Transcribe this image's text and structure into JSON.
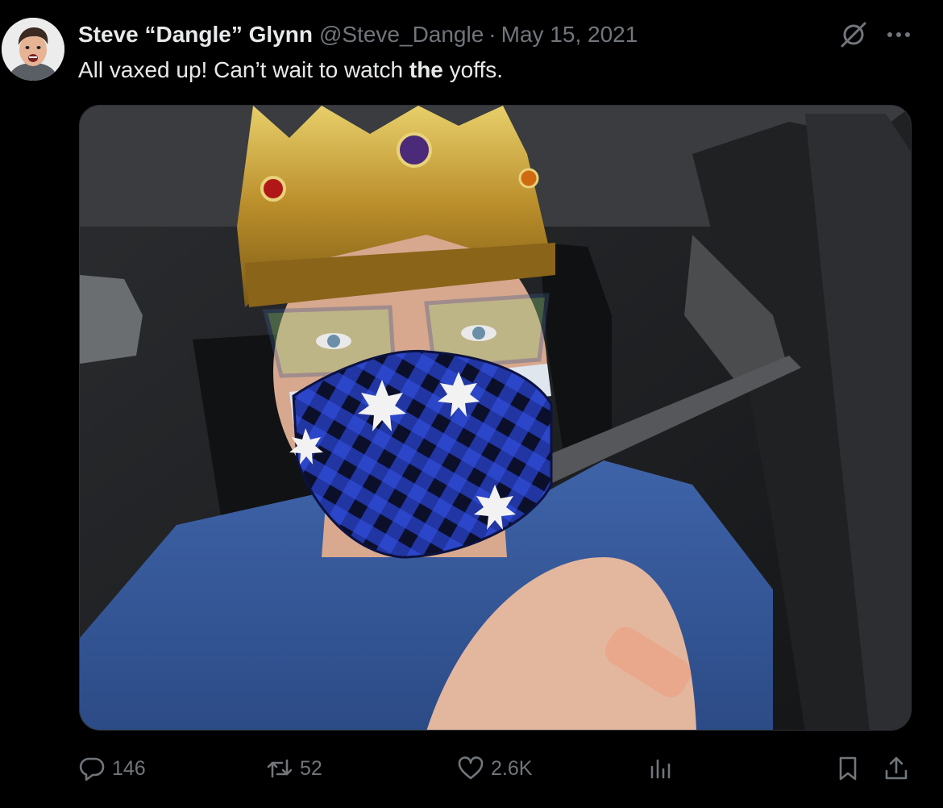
{
  "author": {
    "display_name": "Steve “Dangle” Glynn",
    "handle": "@Steve_Dangle",
    "separator": "·",
    "date": "May 15, 2021",
    "avatar_icon": "avatar-photo"
  },
  "tweet": {
    "text_before": "All vaxed up! Can’t wait to watch ",
    "text_bold": "the",
    "text_after": " yoffs."
  },
  "media": {
    "alt": "Selfie in a car wearing a gold crown, glasses and a Toronto Maple Leafs face mask with a bandage on the shoulder"
  },
  "actions": {
    "replies": "146",
    "reposts": "52",
    "likes": "2.6K",
    "views_icon": "analytics-icon",
    "bookmark_icon": "bookmark-icon",
    "share_icon": "share-icon"
  },
  "colors": {
    "background": "#000000",
    "text_primary": "#e7e9ea",
    "text_secondary": "#71767b",
    "border": "#2f3336"
  }
}
